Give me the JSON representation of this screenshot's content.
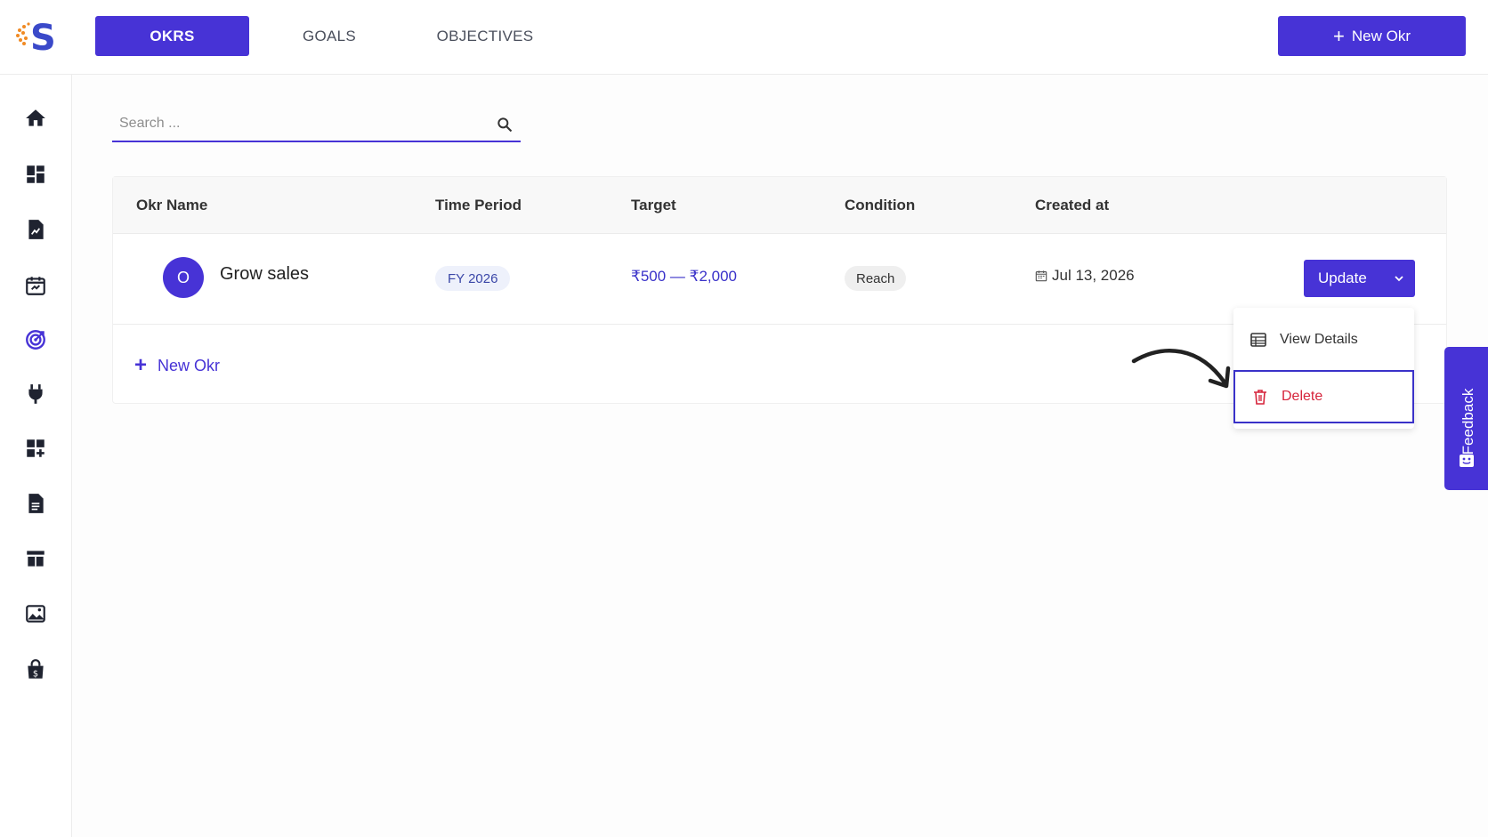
{
  "brand": {
    "logo_letter": "S",
    "accent": "#4733d6"
  },
  "topnav": {
    "tabs": [
      {
        "label": "OKRS",
        "active": true
      },
      {
        "label": "GOALS",
        "active": false
      },
      {
        "label": "OBJECTIVES",
        "active": false
      }
    ],
    "new_okr_label": "New Okr"
  },
  "sidebar": {
    "items": [
      {
        "icon": "home-icon"
      },
      {
        "icon": "dashboard-icon"
      },
      {
        "icon": "chart-report-icon"
      },
      {
        "icon": "calendar-icon"
      },
      {
        "icon": "target-icon",
        "active": true
      },
      {
        "icon": "plug-icon"
      },
      {
        "icon": "add-widget-icon"
      },
      {
        "icon": "document-icon"
      },
      {
        "icon": "storefront-icon"
      },
      {
        "icon": "image-icon"
      },
      {
        "icon": "shopping-bag-icon"
      }
    ]
  },
  "search": {
    "placeholder": "Search ..."
  },
  "table": {
    "headers": [
      "Okr Name",
      "Time Period",
      "Target",
      "Condition",
      "Created at"
    ],
    "rows": [
      {
        "avatar": "O",
        "name": "Grow sales",
        "period": "FY 2026",
        "target": "₹500 — ₹2,000",
        "condition": "Reach",
        "created": "Jul 13, 2026",
        "action": "Update"
      }
    ],
    "new_okr_label": "New Okr"
  },
  "menu": {
    "items": [
      {
        "label": "View Details",
        "icon": "table-icon"
      },
      {
        "label": "Delete",
        "icon": "trash-icon",
        "color": "#d6243b"
      }
    ]
  },
  "feedback": {
    "label": "Feedback"
  }
}
